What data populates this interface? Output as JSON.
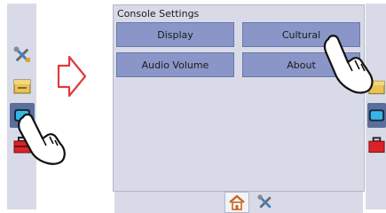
{
  "panel": {
    "title": "Console Settings",
    "buttons": [
      {
        "label": "Display"
      },
      {
        "label": "Cultural"
      },
      {
        "label": "Audio Volume"
      },
      {
        "label": "About"
      }
    ]
  },
  "icons": {
    "side_menu": [
      "tools-icon",
      "folder-icon",
      "console-icon",
      "toolbox-icon"
    ],
    "bottom_tabs": [
      "home-icon",
      "tools-icon"
    ],
    "pointer": "hand-pointer-icon",
    "transition_arrow": "right-arrow-icon"
  },
  "colors": {
    "panel_bg": "#d8dbe7",
    "button_bg": "#8a96c8",
    "active_side": "#5a6f9c",
    "arrow": "#e23a3a",
    "toolbox_red": "#d8232a"
  }
}
